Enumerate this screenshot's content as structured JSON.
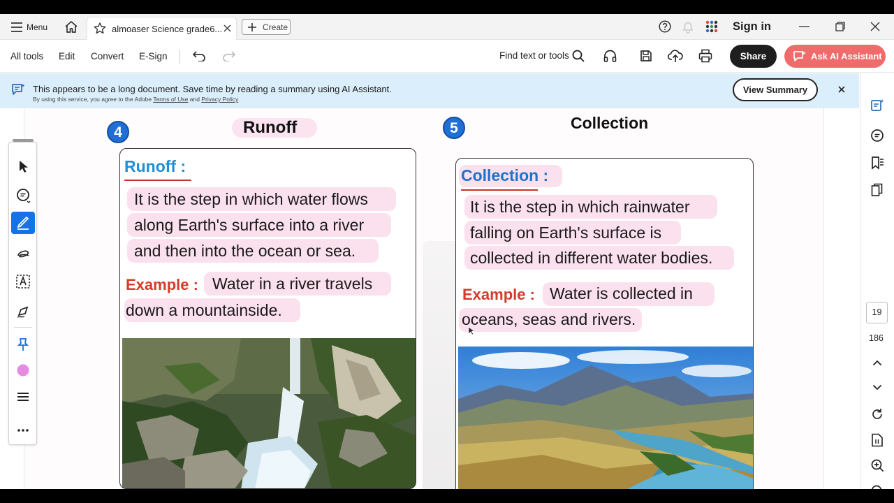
{
  "titlebar": {
    "menu_label": "Menu",
    "tab_title": "almoaser Science grade6...",
    "create_label": "Create",
    "sign_in": "Sign in"
  },
  "toolbar": {
    "all_tools": "All tools",
    "edit": "Edit",
    "convert": "Convert",
    "esign": "E-Sign",
    "find": "Find text or tools",
    "share": "Share",
    "ai_assistant": "Ask AI Assistant"
  },
  "banner": {
    "message": "This appears to be a long document. Save time by reading a summary using AI Assistant.",
    "terms_prefix": "By using this service, you agree to the Adobe",
    "terms_link": "Terms of Use",
    "and": "and",
    "privacy_link": "Privacy Policy",
    "view_summary": "View Summary"
  },
  "page_nav": {
    "current_page": "19",
    "total_pages": "186"
  },
  "document": {
    "section4": {
      "number": "4",
      "heading": "Runoff",
      "term": "Runoff :",
      "definition_lines": [
        "It is the step in which water flows",
        "along Earth's surface into a river",
        "and then into the ocean or sea."
      ],
      "example_label": "Example :",
      "example_line1": "Water in a river travels",
      "example_line2": "down a mountainside."
    },
    "section5": {
      "number": "5",
      "heading": "Collection",
      "term": "Collection :",
      "definition_lines": [
        "It is the step in which rainwater",
        "falling on Earth's surface is",
        "collected in different water bodies."
      ],
      "example_label": "Example :",
      "example_line1": "Water is collected in",
      "example_line2": "oceans, seas and rivers."
    }
  },
  "colors": {
    "term_blue": "#1f8fd6",
    "example_red": "#d63a2a",
    "highlight_pink": "#fbe0ee",
    "ai_button": "#f06b6b",
    "banner_bg": "#dbeefb"
  }
}
